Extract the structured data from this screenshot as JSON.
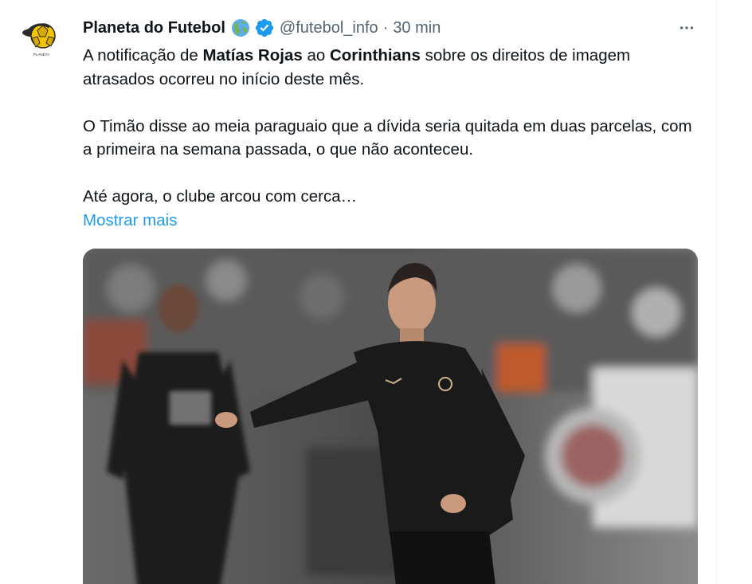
{
  "tweet": {
    "author_name": "Planeta do Futebol",
    "name_emoji": "globe-americas-icon",
    "handle": "@futebol_info",
    "separator": "·",
    "time": "30 min",
    "more_label": "···",
    "text": {
      "p1_a": "A notificação de ",
      "p1_b": "Matías Rojas",
      "p1_c": " ao ",
      "p1_d": "Corinthians",
      "p1_e": " sobre os direitos de imagem atrasados ocorreu no início deste mês.",
      "p2": "O Timão disse ao meia paraguaio que a dívida seria quitada em duas parcelas, com a primeira na semana passada, o que não aconteceu.",
      "p3": "Até agora, o clube arcou com cerca…"
    },
    "show_more": "Mostrar mais"
  },
  "colors": {
    "text": "#0f1419",
    "secondary": "#536471",
    "link": "#1d9bf0",
    "verified": "#1d9bf0"
  },
  "icons": {
    "avatar": "planeta-do-futebol-logo",
    "verified": "verified-badge-icon",
    "more": "more-icon"
  }
}
